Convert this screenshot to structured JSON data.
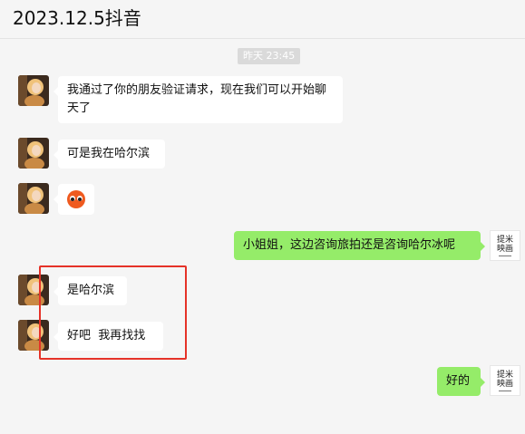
{
  "header": {
    "title": "2023.12.5抖音"
  },
  "chat": {
    "timestamp": "昨天 23:45",
    "messages": [
      {
        "from": "them",
        "text": "我通过了你的朋友验证请求，现在我们可以开始聊天了"
      },
      {
        "from": "them",
        "text": "可是我在哈尔滨"
      },
      {
        "from": "them",
        "emoji": "orange-face-emoji"
      },
      {
        "from": "me",
        "text": "小姐姐，这边咨询旅拍还是咨询哈尔冰呢"
      },
      {
        "from": "them",
        "text": "是哈尔滨"
      },
      {
        "from": "them",
        "text": "好吧  我再找找"
      },
      {
        "from": "me",
        "text": "好的"
      }
    ]
  },
  "self_avatar": {
    "line1": "提米",
    "line2": "映画"
  },
  "colors": {
    "outgoing_bubble": "#95ec69",
    "incoming_bubble": "#ffffff",
    "background": "#f5f5f5",
    "highlight": "#e53228"
  }
}
